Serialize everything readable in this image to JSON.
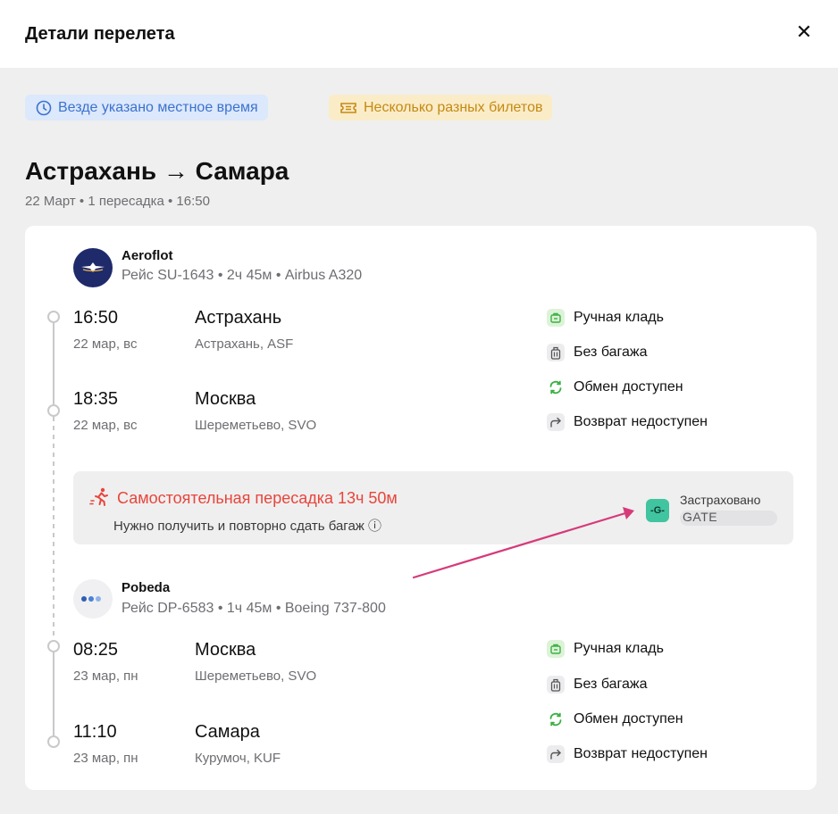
{
  "header": {
    "title": "Детали перелета",
    "close_glyph": "✕"
  },
  "badges": {
    "local_time": "Везде указано местное время",
    "multiple_tickets": "Несколько разных билетов"
  },
  "route": {
    "title": "Астрахань → Самара",
    "meta": "22 Март • 1 пересадка • 16:50"
  },
  "segments": [
    {
      "airline": "Aeroflot",
      "info": "Рейс SU-1643 • 2ч 45м • Airbus A320",
      "departure": {
        "time": "16:50",
        "date": "22 мар, вс",
        "city": "Астрахань",
        "airport": "Астрахань, ASF"
      },
      "arrival": {
        "time": "18:35",
        "date": "22 мар, вс",
        "city": "Москва",
        "airport": "Шереметьево, SVO"
      },
      "features": [
        "Ручная кладь",
        "Без багажа",
        "Обмен доступен",
        "Возврат недоступен"
      ]
    },
    {
      "airline": "Pobeda",
      "info": "Рейс DP-6583 • 1ч 45м • Boeing 737-800",
      "departure": {
        "time": "08:25",
        "date": "23 мар, пн",
        "city": "Москва",
        "airport": "Шереметьево, SVO"
      },
      "arrival": {
        "time": "11:10",
        "date": "23 мар, пн",
        "city": "Самара",
        "airport": "Курумоч, KUF"
      },
      "features": [
        "Ручная кладь",
        "Без багажа",
        "Обмен доступен",
        "Возврат недоступен"
      ]
    }
  ],
  "transfer": {
    "title": "Самостоятельная пересадка 13ч 50м",
    "subtitle": "Нужно получить и повторно сдать багаж ⓘ",
    "insurance_label": "Застраховано",
    "insurance_provider": "GATE",
    "insurance_logo_text": "-G-"
  },
  "colors": {
    "accent_blue": "#3b72cf",
    "warning_yellow": "#c48a12",
    "transfer_red": "#e8453c",
    "feature_green": "#3cb043",
    "annotation_pink": "#d63a7a"
  }
}
